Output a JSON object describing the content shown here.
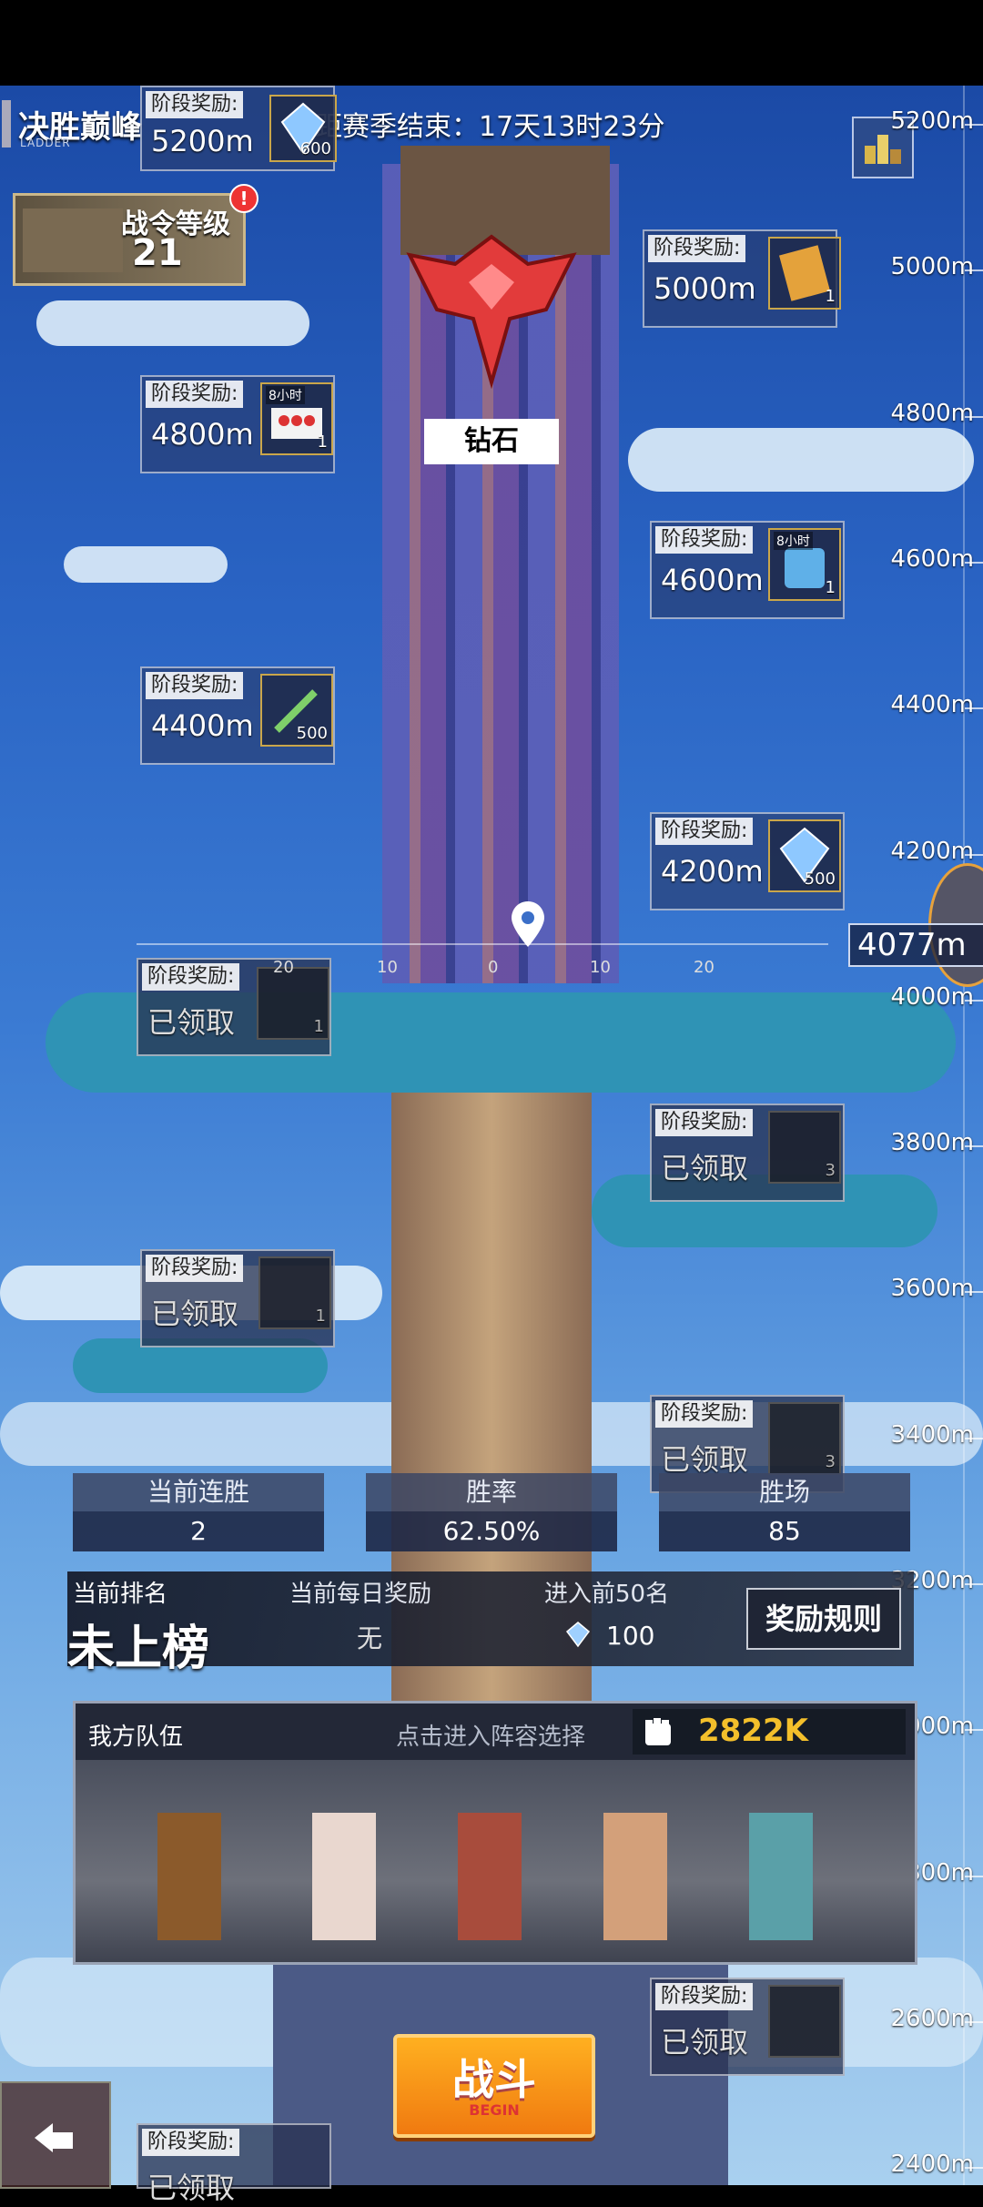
{
  "header": {
    "title": "决胜巅峰",
    "subtitle": "LADDER",
    "season_end": "距赛季结束：17天13时23分"
  },
  "battle_pass": {
    "label": "战令等级",
    "level": "21",
    "badge": "!"
  },
  "league": {
    "name": "钻石"
  },
  "ruler": {
    "labels": [
      "5200m",
      "5000m",
      "4800m",
      "4600m",
      "4400m",
      "4200m",
      "4000m",
      "3800m",
      "3600m",
      "3400m",
      "3200m",
      "3000m",
      "2800m",
      "2600m",
      "2400m"
    ]
  },
  "current_height": "4077m",
  "slider_ticks": [
    "20",
    "10",
    "0",
    "10",
    "20"
  ],
  "rewards": [
    {
      "header": "阶段奖励:",
      "value": "5200m",
      "qty": "600",
      "icon": "crystal-icon",
      "tag": ""
    },
    {
      "header": "阶段奖励:",
      "value": "5000m",
      "qty": "1",
      "icon": "card-icon",
      "tag": ""
    },
    {
      "header": "阶段奖励:",
      "value": "4800m",
      "qty": "1",
      "icon": "medkit-icon",
      "tag": "8小时"
    },
    {
      "header": "阶段奖励:",
      "value": "4600m",
      "qty": "1",
      "icon": "supply-tank-icon",
      "tag": "8小时"
    },
    {
      "header": "阶段奖励:",
      "value": "4400m",
      "qty": "500",
      "icon": "syringe-icon",
      "tag": ""
    },
    {
      "header": "阶段奖励:",
      "value": "4200m",
      "qty": "500",
      "icon": "crystal-icon",
      "tag": ""
    },
    {
      "header": "阶段奖励:",
      "value": "已领取",
      "qty": "1",
      "icon": "card-icon",
      "tag": ""
    },
    {
      "header": "阶段奖励:",
      "value": "已领取",
      "qty": "3",
      "icon": "scroll-icon",
      "tag": ""
    },
    {
      "header": "阶段奖励:",
      "value": "已领取",
      "qty": "1",
      "icon": "building-icon",
      "tag": ""
    },
    {
      "header": "阶段奖励:",
      "value": "已领取",
      "qty": "3",
      "icon": "ticket-icon",
      "tag": ""
    },
    {
      "header": "阶段奖励:",
      "value": "已领取",
      "qty": "",
      "icon": "mystery-icon",
      "tag": ""
    },
    {
      "header": "阶段奖励:",
      "value": "已领取",
      "qty": "",
      "icon": "card-icon",
      "tag": ""
    }
  ],
  "stats": {
    "streak_label": "当前连胜",
    "streak": "2",
    "winrate_label": "胜率",
    "winrate": "62.50%",
    "wins_label": "胜场",
    "wins": "85"
  },
  "ranking": {
    "current_label": "当前排名",
    "current": "未上榜",
    "daily_label": "当前每日奖励",
    "daily": "无",
    "enter_label": "进入前50名",
    "enter_reward": "100",
    "rules_button": "奖励规则"
  },
  "team": {
    "title": "我方队伍",
    "hint": "点击进入阵容选择",
    "power": "2822K"
  },
  "fight": {
    "label": "战斗",
    "sub": "BEGIN"
  },
  "colors": {
    "accent": "#f3bf2b",
    "fight": "#f07a10",
    "sky": "#2a64c4",
    "badge": "#e33333"
  }
}
